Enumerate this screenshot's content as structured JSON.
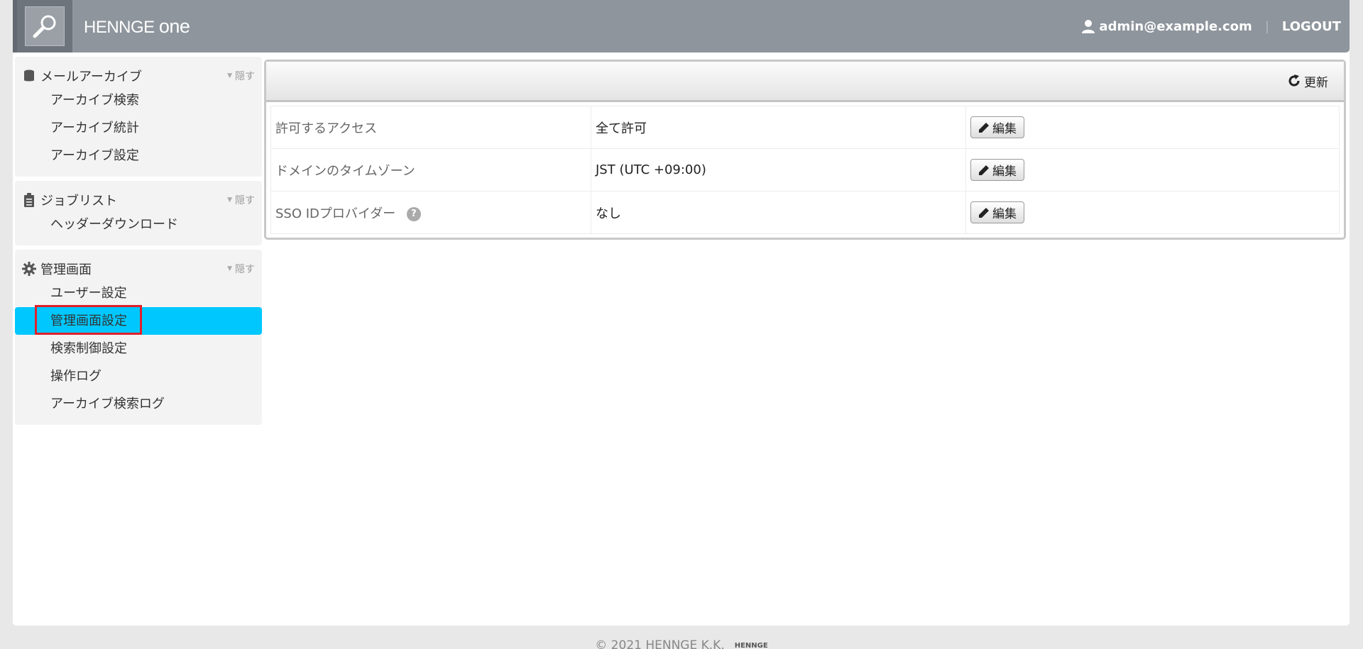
{
  "header": {
    "brand": "HENNGE",
    "brand_suffix": "one",
    "user_email": "admin@example.com",
    "separator": "|",
    "logout_label": "LOGOUT"
  },
  "sidebar": {
    "sections": [
      {
        "title": "メールアーカイブ",
        "icon": "database-icon",
        "hide_label": "隠す",
        "items": [
          {
            "label": "アーカイブ検索"
          },
          {
            "label": "アーカイブ統計"
          },
          {
            "label": "アーカイブ設定"
          }
        ]
      },
      {
        "title": "ジョブリスト",
        "icon": "clipboard-icon",
        "hide_label": "隠す",
        "items": [
          {
            "label": "ヘッダーダウンロード"
          }
        ]
      },
      {
        "title": "管理画面",
        "icon": "gear-icon",
        "hide_label": "隠す",
        "items": [
          {
            "label": "ユーザー設定"
          },
          {
            "label": "管理画面設定",
            "active": true
          },
          {
            "label": "検索制御設定"
          },
          {
            "label": "操作ログ"
          },
          {
            "label": "アーカイブ検索ログ"
          }
        ]
      }
    ]
  },
  "main": {
    "refresh_label": "更新",
    "rows": [
      {
        "label": "許可するアクセス",
        "value": "全て許可",
        "edit_label": "編集"
      },
      {
        "label": "ドメインのタイムゾーン",
        "value": "JST (UTC +09:00)",
        "edit_label": "編集"
      },
      {
        "label": "SSO IDプロバイダー",
        "help": "?",
        "value": "なし",
        "edit_label": "編集"
      }
    ]
  },
  "footer": {
    "copyright": "© 2021 HENNGE K.K.",
    "logo_text": "HENNGE"
  },
  "colors": {
    "header_bg": "#8e959c",
    "active_item_bg": "#00c8ff",
    "highlight_border": "#e0202a"
  }
}
